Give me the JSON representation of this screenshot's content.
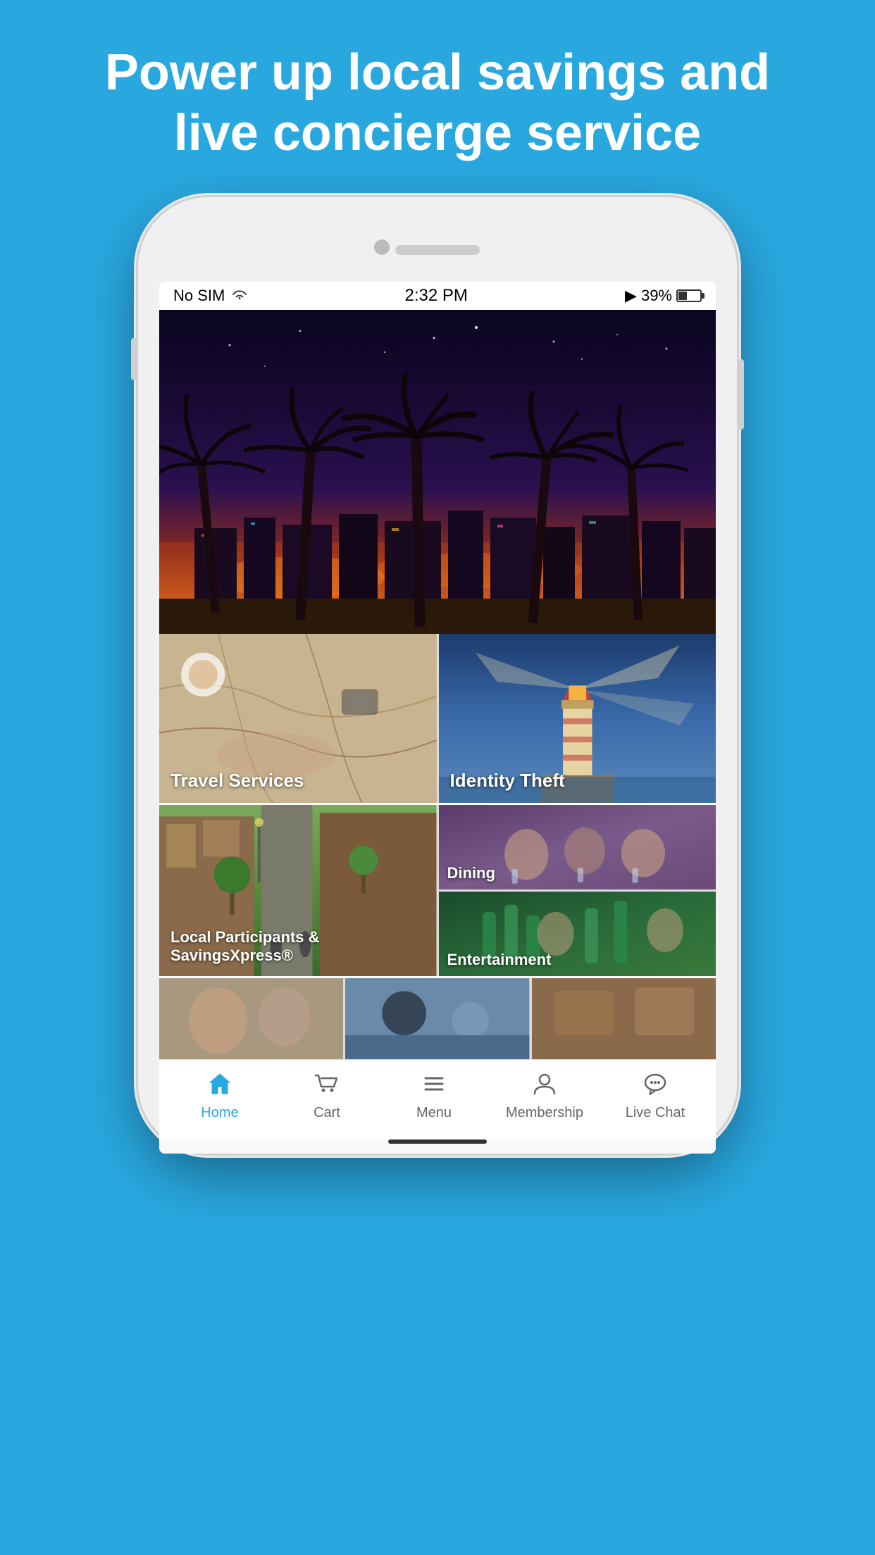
{
  "background_color": "#29a8e0",
  "header": {
    "title": "Power up local savings and live concierge service"
  },
  "status_bar": {
    "carrier": "No SIM",
    "time": "2:32 PM",
    "battery": "39%",
    "signal_icon": "wifi"
  },
  "hero": {
    "description": "Miami beach palm trees night scene"
  },
  "services": [
    {
      "id": "travel",
      "label": "Travel Services"
    },
    {
      "id": "identity",
      "label": "Identity Theft"
    },
    {
      "id": "local",
      "label": "Local Participants & SavingsXpress®"
    },
    {
      "id": "dining",
      "label": "Dining"
    },
    {
      "id": "entertainment",
      "label": "Entertainment"
    }
  ],
  "bottom_nav": [
    {
      "id": "home",
      "label": "Home",
      "icon": "🏠",
      "active": true
    },
    {
      "id": "cart",
      "label": "Cart",
      "icon": "🛒",
      "active": false
    },
    {
      "id": "menu",
      "label": "Menu",
      "icon": "☰",
      "active": false
    },
    {
      "id": "membership",
      "label": "Membership",
      "icon": "👤",
      "active": false
    },
    {
      "id": "livechat",
      "label": "Live Chat",
      "icon": "💬",
      "active": false
    }
  ]
}
